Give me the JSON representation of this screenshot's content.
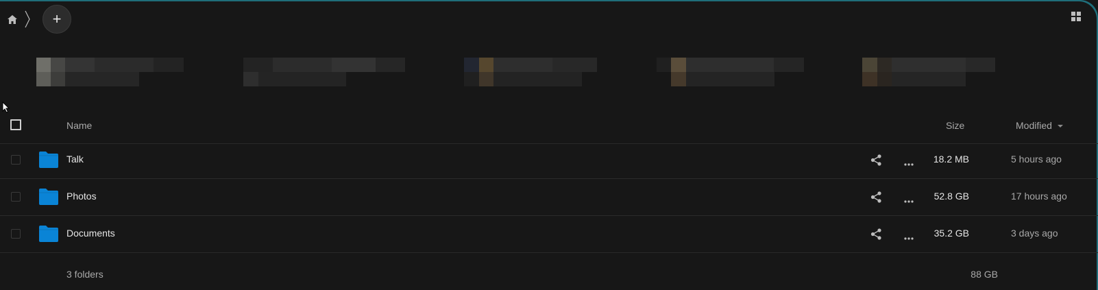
{
  "breadcrumb": {
    "home_icon": "home-icon",
    "separator_icon": "chevron-right-icon"
  },
  "new_button": {
    "label": "+"
  },
  "view_toggle_icon": "grid-view-icon",
  "table": {
    "headers": {
      "name": "Name",
      "size": "Size",
      "modified": "Modified"
    },
    "rows": [
      {
        "name": "Talk",
        "size": "18.2 MB",
        "modified": "5 hours ago"
      },
      {
        "name": "Photos",
        "size": "52.8 GB",
        "modified": "17 hours ago"
      },
      {
        "name": "Documents",
        "size": "35.2 GB",
        "modified": "3 days ago"
      }
    ],
    "footer": {
      "count": "3 folders",
      "total": "88 GB"
    }
  },
  "colors": {
    "background": "#171717",
    "folder": "#0a84d6",
    "accent_border": "#1f6e7a"
  }
}
